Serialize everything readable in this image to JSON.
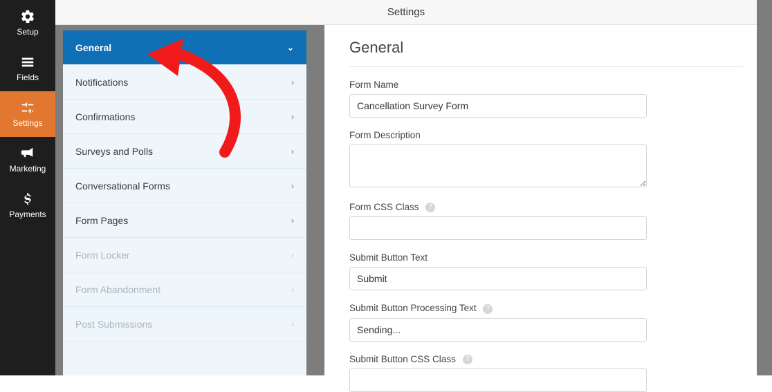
{
  "header": {
    "title": "Settings"
  },
  "vnav": {
    "items": [
      {
        "label": "Setup"
      },
      {
        "label": "Fields"
      },
      {
        "label": "Settings"
      },
      {
        "label": "Marketing"
      },
      {
        "label": "Payments"
      }
    ]
  },
  "subpanel": {
    "items": [
      {
        "label": "General",
        "active": true
      },
      {
        "label": "Notifications"
      },
      {
        "label": "Confirmations"
      },
      {
        "label": "Surveys and Polls"
      },
      {
        "label": "Conversational Forms"
      },
      {
        "label": "Form Pages"
      },
      {
        "label": "Form Locker",
        "disabled": true
      },
      {
        "label": "Form Abandonment",
        "disabled": true
      },
      {
        "label": "Post Submissions",
        "disabled": true
      }
    ]
  },
  "main": {
    "heading": "General",
    "form_name_label": "Form Name",
    "form_name_value": "Cancellation Survey Form",
    "form_description_label": "Form Description",
    "form_description_value": "",
    "form_css_class_label": "Form CSS Class",
    "form_css_class_value": "",
    "submit_button_text_label": "Submit Button Text",
    "submit_button_text_value": "Submit",
    "submit_button_processing_label": "Submit Button Processing Text",
    "submit_button_processing_value": "Sending...",
    "submit_button_css_class_label": "Submit Button CSS Class",
    "submit_button_css_class_value": "",
    "help_glyph": "?"
  },
  "annotation": {
    "type": "arrow",
    "color": "#f11a1a"
  }
}
